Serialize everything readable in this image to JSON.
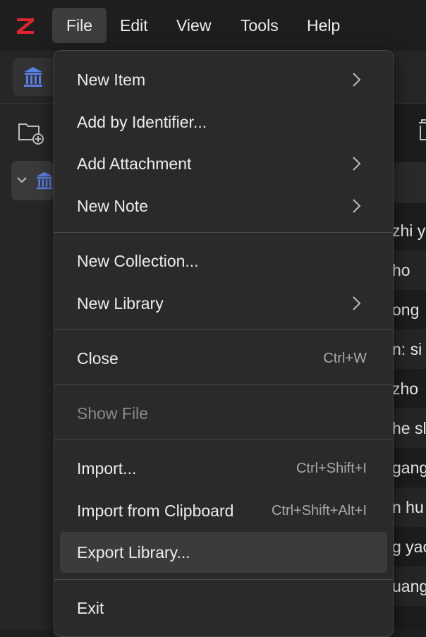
{
  "menubar": {
    "items": [
      "File",
      "Edit",
      "View",
      "Tools",
      "Help"
    ]
  },
  "file_menu": {
    "new_item": "New Item",
    "add_by_identifier": "Add by Identifier...",
    "add_attachment": "Add Attachment",
    "new_note": "New Note",
    "new_collection": "New Collection...",
    "new_library": "New Library",
    "close": "Close",
    "close_shortcut": "Ctrl+W",
    "show_file": "Show File",
    "import": "Import...",
    "import_shortcut": "Ctrl+Shift+I",
    "import_clipboard": "Import from Clipboard",
    "import_clipboard_shortcut": "Ctrl+Shift+Alt+I",
    "export_library": "Export Library...",
    "exit": "Exit"
  },
  "items_list": {
    "rows": [
      "zhi y",
      "ho",
      "ong",
      "n: si",
      "zho",
      "he sl",
      "gang",
      "n hu",
      "g yac",
      "uang"
    ]
  },
  "colors": {
    "accent": "#e0232e",
    "library_icon": "#5a7fe6"
  }
}
